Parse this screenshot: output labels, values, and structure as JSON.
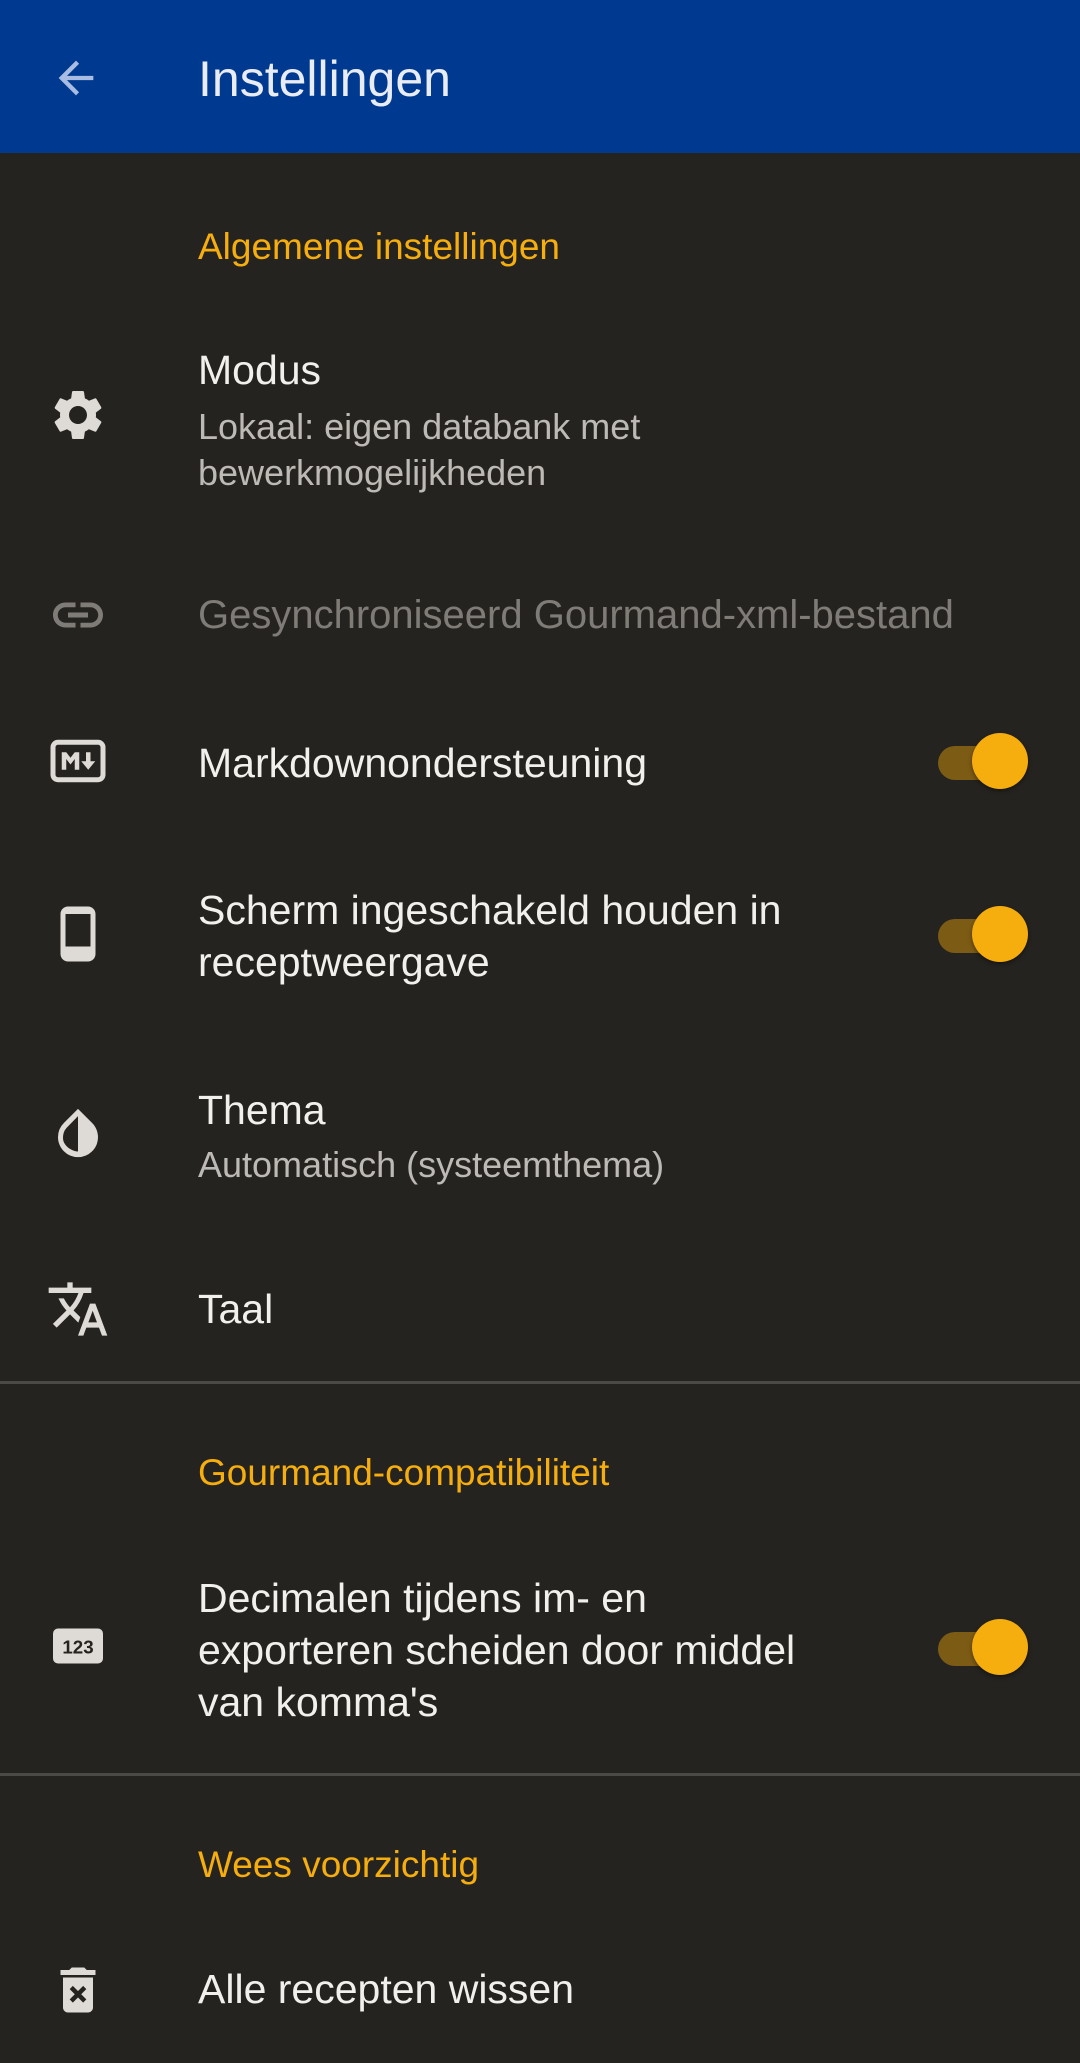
{
  "appbar": {
    "title": "Instellingen",
    "back_icon": "arrow-back-icon"
  },
  "colors": {
    "appbar": "#003a90",
    "background": "#252320",
    "accent": "#f6ad0e"
  },
  "sections": {
    "general": {
      "header": "Algemene instellingen",
      "mode": {
        "title": "Modus",
        "summary": "Lokaal: eigen databank met bewerkmogelijkheden",
        "icon": "gear-icon"
      },
      "sync": {
        "title": "Gesynchroniseerd Gourmand-xml-bestand",
        "icon": "link-icon",
        "enabled": false
      },
      "markdown": {
        "title": "Markdownondersteuning",
        "icon": "markdown-icon",
        "checked": true
      },
      "screen": {
        "title": "Scherm ingeschakeld houden in receptweergave",
        "icon": "phone-icon",
        "checked": true
      },
      "theme": {
        "title": "Thema",
        "summary": "Automatisch (systeemthema)",
        "icon": "contrast-icon"
      },
      "language": {
        "title": "Taal",
        "icon": "translate-icon"
      }
    },
    "gourmand": {
      "header": "Gourmand-compatibiliteit",
      "decimals": {
        "title": "Decimalen tijdens im- en exporteren scheiden door middel van komma's",
        "icon": "numbers-icon",
        "checked": true
      }
    },
    "careful": {
      "header": "Wees voorzichtig",
      "delete": {
        "title": "Alle recepten wissen",
        "icon": "delete-icon"
      }
    }
  }
}
